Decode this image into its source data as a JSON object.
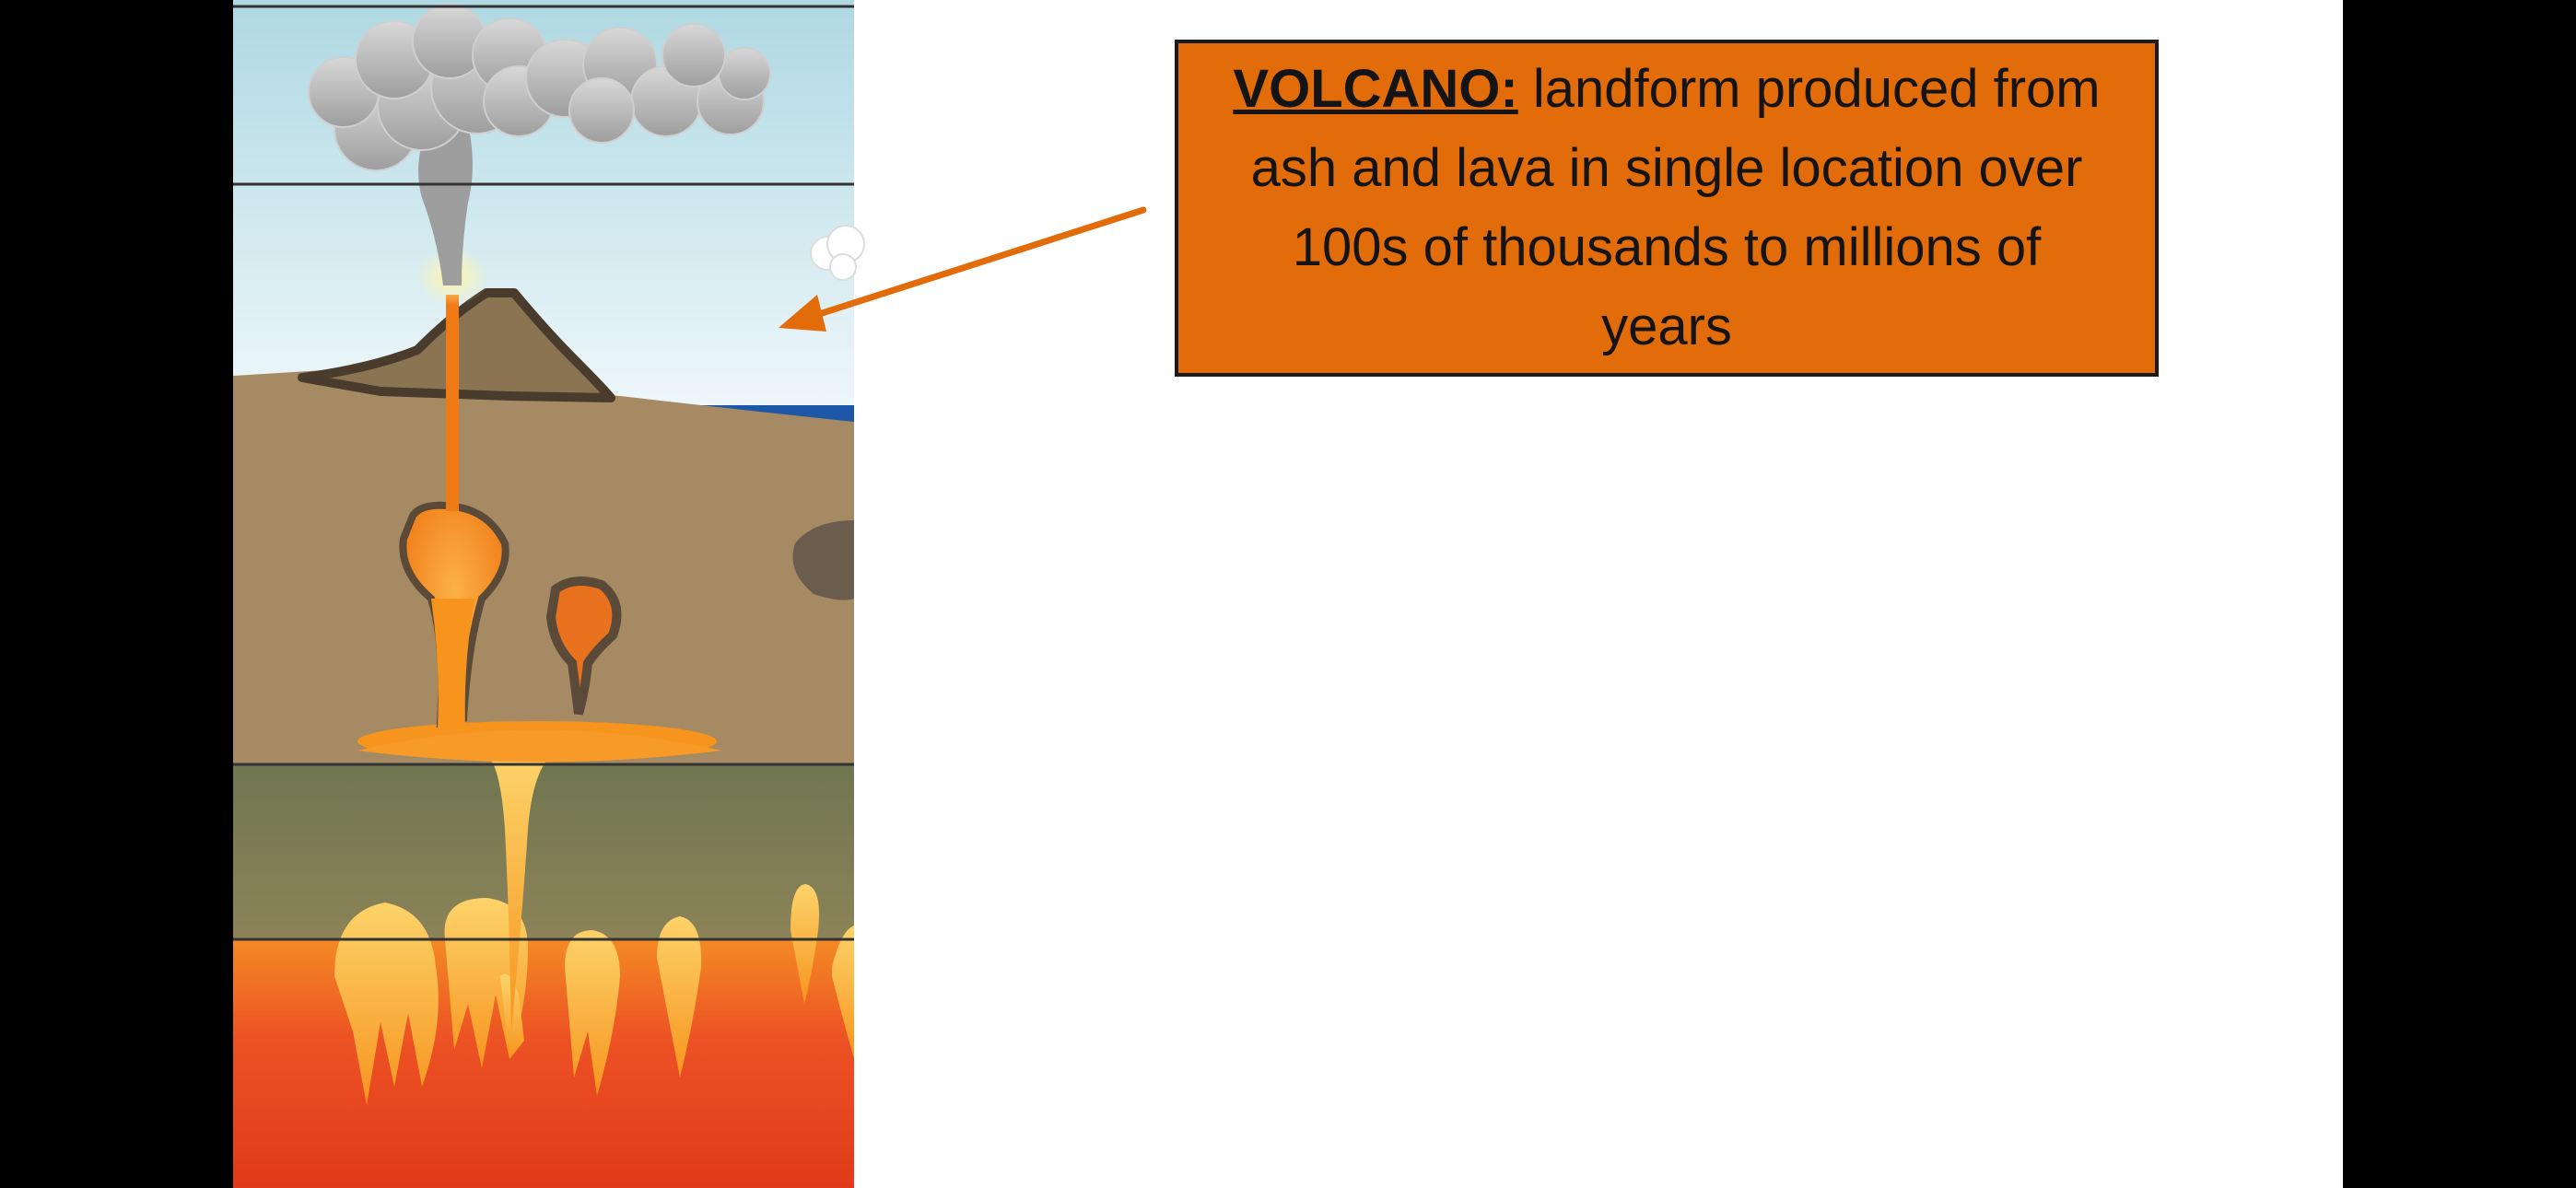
{
  "slide": {
    "background": "#ffffff",
    "letterbox_color": "#000000"
  },
  "definition": {
    "term": "VOLCANO:",
    "text": "landform produced from ash and lava in single location over 100s of thousands to millions of years",
    "box_color": "#e26b0a",
    "border_color": "#1a1a1a",
    "text_color": "#141414"
  },
  "arrow": {
    "color": "#e26b0a"
  },
  "diagram": {
    "colors": {
      "sky_top": "#aed8e2",
      "sky_bottom": "#e9f5f9",
      "crust": "#a58a64",
      "mantle_upper": "#7a7a56",
      "mantle_lower": "#e53a1e",
      "magma": "#f7941e",
      "magma_light": "#fcd36a",
      "ocean": "#1d57a8",
      "ash_cloud": "#bdbdbd",
      "layer_line": "#333333"
    },
    "icons": [
      "ash-cloud-icon",
      "volcano-cone-icon",
      "magma-chamber-icon",
      "mantle-plume-icon"
    ]
  }
}
